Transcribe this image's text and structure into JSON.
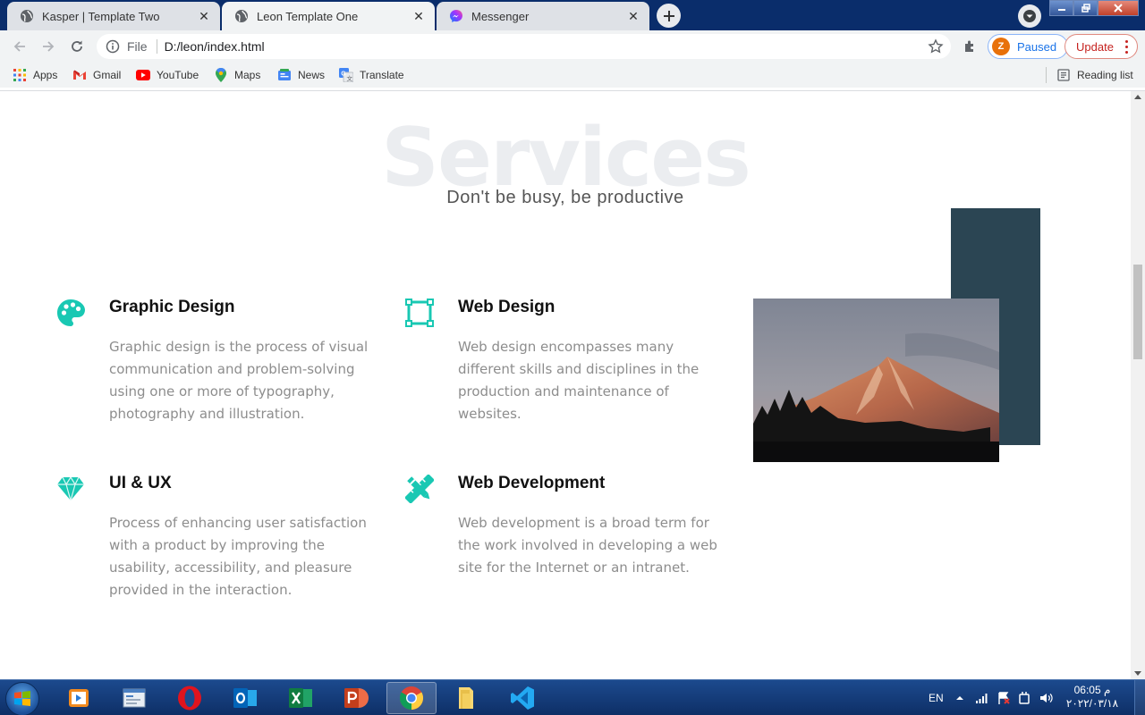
{
  "browser": {
    "tabs": [
      {
        "title": "Kasper | Template Two",
        "active": false,
        "icon": "globe-icon"
      },
      {
        "title": "Leon Template One",
        "active": true,
        "icon": "globe-icon"
      },
      {
        "title": "Messenger",
        "active": false,
        "icon": "messenger-icon"
      }
    ],
    "address": {
      "scheme": "File",
      "url": "D:/leon/index.html"
    },
    "profile": {
      "avatar_letter": "Z",
      "status": "Paused"
    },
    "update_label": "Update",
    "bookmarks": [
      {
        "label": "Apps",
        "icon": "apps-grid-icon"
      },
      {
        "label": "Gmail",
        "icon": "gmail-icon"
      },
      {
        "label": "YouTube",
        "icon": "youtube-icon"
      },
      {
        "label": "Maps",
        "icon": "maps-icon"
      },
      {
        "label": "News",
        "icon": "news-icon"
      },
      {
        "label": "Translate",
        "icon": "translate-icon"
      }
    ],
    "reading_list": "Reading list"
  },
  "page": {
    "section_title": "Services",
    "section_subtitle": "Don't be busy, be productive",
    "services": [
      {
        "title": "Graphic Design",
        "icon": "palette-icon",
        "text": "Graphic design is the process of visual communication and problem-solving using one or more of typography, photography and illustration."
      },
      {
        "title": "Web Design",
        "icon": "vector-square-icon",
        "text": "Web design encompasses many different skills and disciplines in the production and maintenance of websites."
      },
      {
        "title": "UI & UX",
        "icon": "gem-icon",
        "text": "Process of enhancing user satisfaction with a product by improving the usability, accessibility, and pleasure provided in the interaction."
      },
      {
        "title": "Web Development",
        "icon": "pencil-ruler-icon",
        "text": "Web development is a broad term for the work involved in developing a web site for the Internet or an intranet."
      }
    ],
    "accent_color": "#19c8b3",
    "deco_color": "#2b4553"
  },
  "taskbar": {
    "apps": [
      "media-player-icon",
      "file-manager-icon",
      "opera-icon",
      "outlook-icon",
      "excel-icon",
      "powerpoint-icon",
      "chrome-icon",
      "folder-icon",
      "vscode-icon"
    ],
    "language": "EN",
    "time": "06:05 م",
    "date": "٢٠٢٢/٠٣/١٨"
  }
}
